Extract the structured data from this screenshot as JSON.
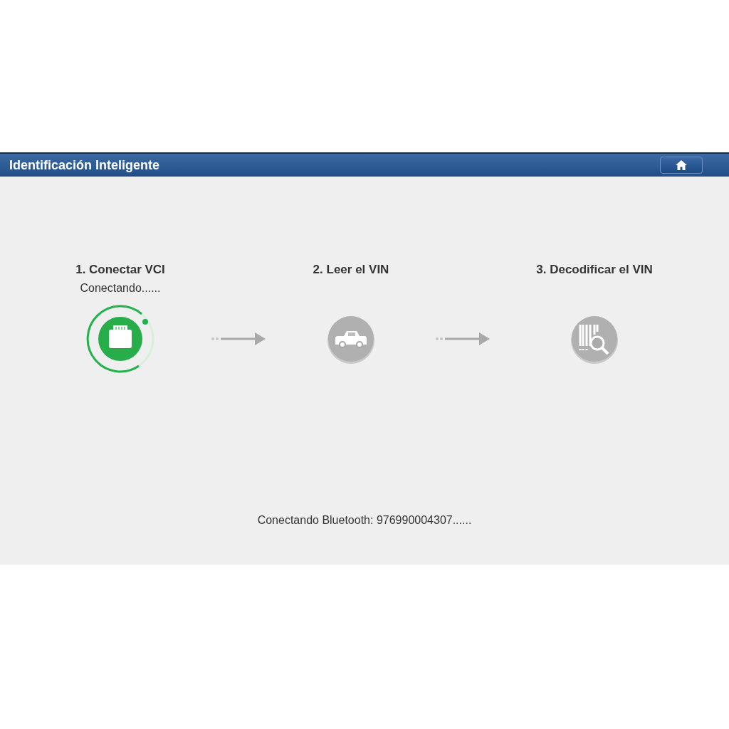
{
  "header": {
    "title": "Identificación Inteligente"
  },
  "steps": [
    {
      "title": "1. Conectar VCI",
      "status": "Conectando......",
      "kind": "connector",
      "active": true
    },
    {
      "title": "2. Leer el VIN",
      "kind": "car",
      "active": false
    },
    {
      "title": "3. Decodificar el VIN",
      "kind": "barcode",
      "active": false
    }
  ],
  "status_message": "Conectando Bluetooth: 976990004307......"
}
